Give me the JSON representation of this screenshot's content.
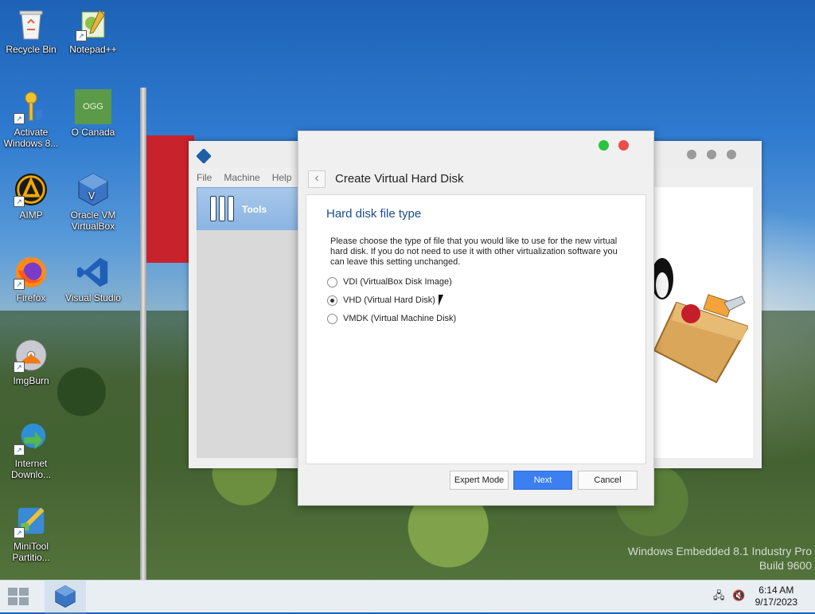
{
  "desktop": {
    "icons": [
      {
        "label": "Recycle Bin",
        "icon": "recycle-bin-icon"
      },
      {
        "label": "Notepad++",
        "icon": "notepad-plus-plus-icon"
      },
      {
        "label": "Activate Windows 8...",
        "icon": "key-icon"
      },
      {
        "label": "O Canada",
        "icon": "ogg-file-icon",
        "badge": "OGG"
      },
      {
        "label": "AIMP",
        "icon": "aimp-icon"
      },
      {
        "label": "Oracle VM VirtualBox",
        "icon": "virtualbox-icon"
      },
      {
        "label": "Firefox",
        "icon": "firefox-icon"
      },
      {
        "label": "Visual Studio",
        "icon": "visual-studio-icon"
      },
      {
        "label": "ImgBurn",
        "icon": "imgburn-icon"
      },
      {
        "label": "Internet Downlo...",
        "icon": "internet-download-manager-icon"
      },
      {
        "label": "MiniTool Partitio...",
        "icon": "minitool-partition-icon"
      }
    ]
  },
  "vbox_manager": {
    "menu": [
      "File",
      "Machine",
      "Help"
    ],
    "tools_label": "Tools"
  },
  "dialog": {
    "title": "Create Virtual Hard Disk",
    "section_title": "Hard disk file type",
    "description": "Please choose the type of file that you would like to use for the new virtual hard disk. If you do not need to use it with other virtualization software you can leave this setting unchanged.",
    "options": [
      {
        "label": "VDI (VirtualBox Disk Image)",
        "checked": false
      },
      {
        "label": "VHD (Virtual Hard Disk)",
        "checked": true
      },
      {
        "label": "VMDK (Virtual Machine Disk)",
        "checked": false
      }
    ],
    "buttons": {
      "expert": "Expert Mode",
      "next": "Next",
      "cancel": "Cancel"
    }
  },
  "watermark": {
    "line1": "Windows Embedded 8.1 Industry Pro",
    "line2": "Build 9600"
  },
  "taskbar": {
    "time": "6:14 AM",
    "date": "9/17/2023",
    "tray_icons": [
      "network-icon",
      "volume-muted-icon"
    ]
  },
  "colors": {
    "accent": "#3b7ff0",
    "section_title": "#1b4c8c",
    "close_dot": "#ee4c4c",
    "max_dot": "#29c440"
  }
}
